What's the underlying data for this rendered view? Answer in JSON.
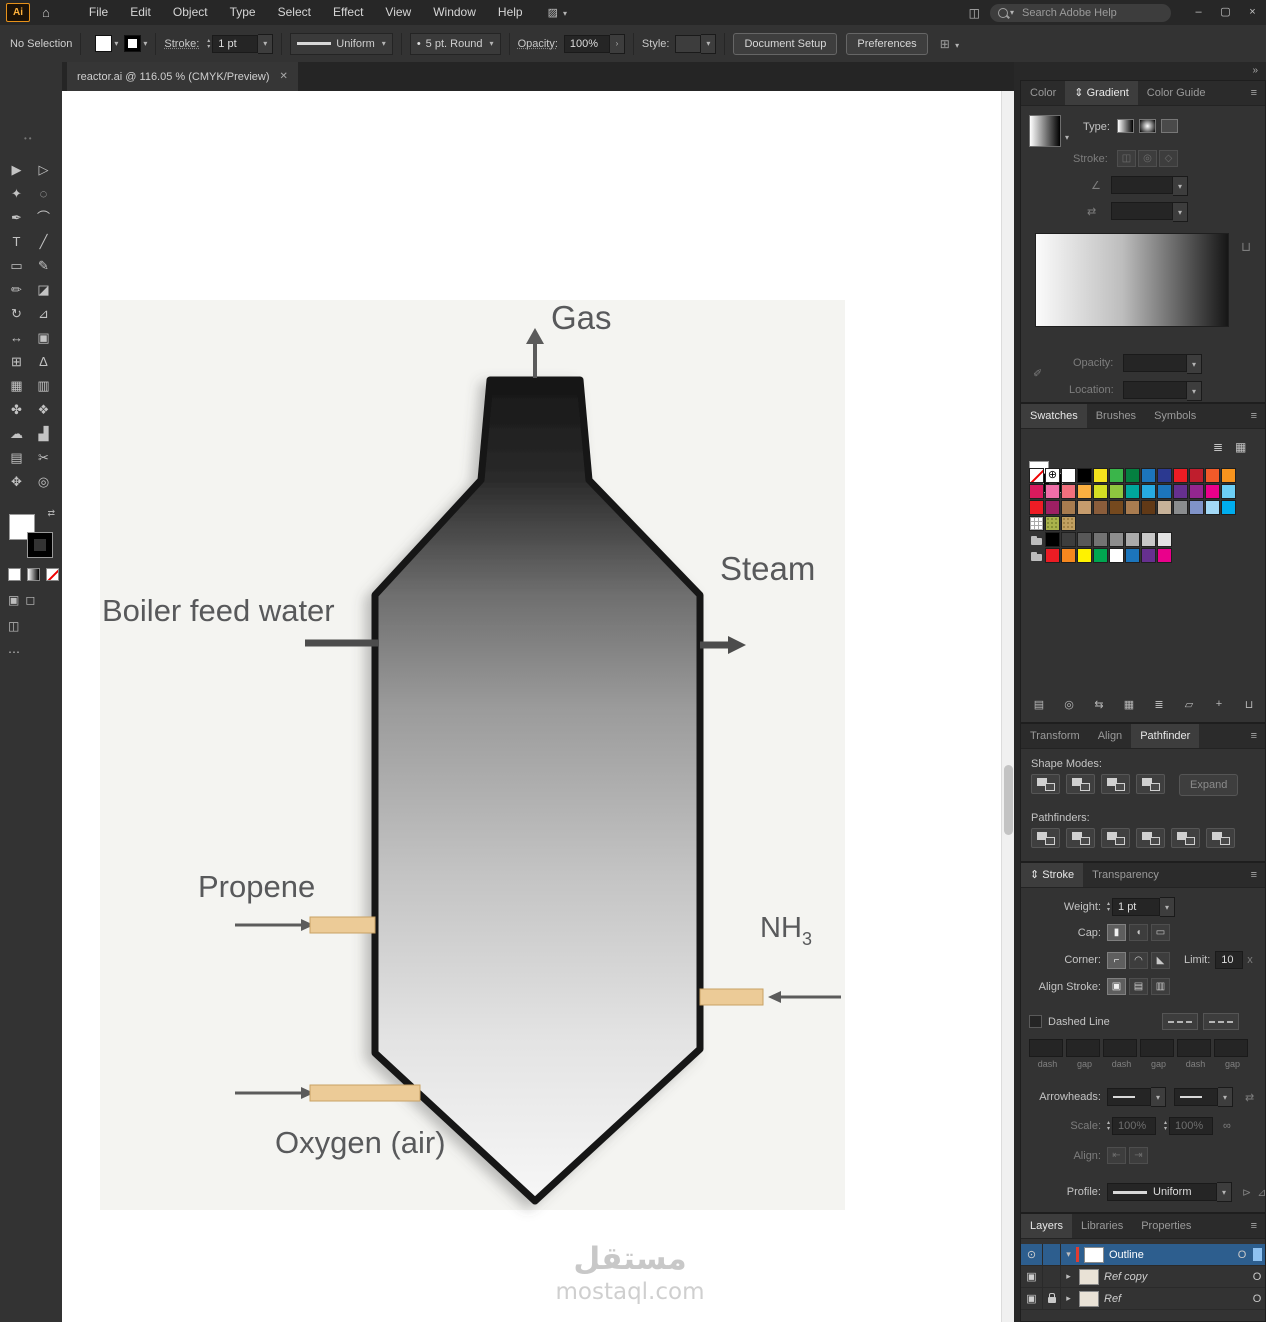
{
  "app": {
    "logo": "Ai",
    "menus": [
      "File",
      "Edit",
      "Object",
      "Type",
      "Select",
      "Effect",
      "View",
      "Window",
      "Help"
    ],
    "search": {
      "placeholder": "Search Adobe Help"
    },
    "window": {
      "minimize": "–",
      "restore": "▢",
      "close": "×"
    }
  },
  "control_bar": {
    "selection": "No Selection",
    "stroke_label": "Stroke:",
    "stroke_value": "1 pt",
    "variable_width": "Uniform",
    "brush": "5 pt. Round",
    "opacity_label": "Opacity:",
    "opacity_value": "100%",
    "style_label": "Style:",
    "document_setup": "Document Setup",
    "preferences": "Preferences"
  },
  "toolbar": {
    "tools": [
      {
        "name": "selection",
        "glyph": "▶"
      },
      {
        "name": "direct-selection",
        "glyph": "▷"
      },
      {
        "name": "magic-wand",
        "glyph": "✦"
      },
      {
        "name": "lasso",
        "glyph": "◌"
      },
      {
        "name": "pen",
        "glyph": "✒"
      },
      {
        "name": "curvature",
        "glyph": "⌒"
      },
      {
        "name": "type",
        "glyph": "T"
      },
      {
        "name": "line-segment",
        "glyph": "╱"
      },
      {
        "name": "rectangle",
        "glyph": "▭"
      },
      {
        "name": "paintbrush",
        "glyph": "✎"
      },
      {
        "name": "pencil",
        "glyph": "✏"
      },
      {
        "name": "eraser",
        "glyph": "◪"
      },
      {
        "name": "rotate",
        "glyph": "↻"
      },
      {
        "name": "scale",
        "glyph": "⊿"
      },
      {
        "name": "width",
        "glyph": "↔"
      },
      {
        "name": "free-transform",
        "glyph": "▣"
      },
      {
        "name": "shape-builder",
        "glyph": "⊞"
      },
      {
        "name": "perspective-grid",
        "glyph": "∆"
      },
      {
        "name": "mesh",
        "glyph": "▦"
      },
      {
        "name": "gradient",
        "glyph": "▥"
      },
      {
        "name": "eyedropper",
        "glyph": "✤"
      },
      {
        "name": "blend",
        "glyph": "❖"
      },
      {
        "name": "symbol-sprayer",
        "glyph": "☁"
      },
      {
        "name": "column-graph",
        "glyph": "▟"
      },
      {
        "name": "artboard",
        "glyph": "▤"
      },
      {
        "name": "slice",
        "glyph": "✂"
      },
      {
        "name": "hand",
        "glyph": "✥"
      },
      {
        "name": "zoom",
        "glyph": "◎"
      }
    ]
  },
  "document_tab": {
    "title": "reactor.ai @ 116.05 % (CMYK/Preview)",
    "close": "✕"
  },
  "diagram": {
    "gas": "Gas",
    "steam": "Steam",
    "boiler_feed_water": "Boiler feed water",
    "propene": "Propene",
    "nh": "NH",
    "nh_sub": "3",
    "oxygen": "Oxygen (air)",
    "watermark_line1": "مستقل",
    "watermark_line2": "mostaql.com",
    "pipe_color": "#eccb97",
    "pipe_border": "#c9a264",
    "label_color": "#58595b"
  },
  "panels": {
    "gradient": {
      "tabs": {
        "items": [
          "Color",
          "Gradient",
          "Color Guide"
        ],
        "active": 1,
        "prefix": "⇕"
      },
      "type_label": "Type:",
      "stroke_label": "Stroke:",
      "opacity_label": "Opacity:",
      "location_label": "Location:"
    },
    "swatches": {
      "tabs": {
        "items": [
          "Swatches",
          "Brushes",
          "Symbols"
        ],
        "active": 0
      },
      "rows": [
        [
          "none",
          "reg",
          "#ffffff",
          "#000000",
          "#f5e31c",
          "#3ab54a",
          "#047f40",
          "#1c75bc",
          "#2b3990",
          "#ed1c24",
          "#bf1e2d",
          "#f15a29",
          "#f7941e"
        ],
        [
          "#d91a5d",
          "#ef6ea8",
          "#f2707d",
          "#fbb041",
          "#d6de23",
          "#8ec63f",
          "#00a69c",
          "#27aae1",
          "#1c75bc",
          "#66308f",
          "#93268f",
          "#ea008b",
          "#6dcff6"
        ],
        [
          "#ee1c25",
          "#9e1f63",
          "#a87c4f",
          "#c69c6d",
          "#8a5d3b",
          "#75491e",
          "#a97c50",
          "#613916",
          "#c7b299",
          "#8a8c8e",
          "#8093c8",
          "#a3d9f6",
          "#00adee"
        ],
        [
          "pattern",
          "tex1",
          "tex2"
        ],
        [
          "folder",
          "#000000",
          "#3d3d3d",
          "#585858",
          "#737373",
          "#8e8e8e",
          "#ababab",
          "#c8c8c8",
          "#e3e3e3"
        ],
        [
          "folder",
          "#ec1c24",
          "#f6871f",
          "#fff200",
          "#00a650",
          "#ffffff",
          "#1c75bc",
          "#66308f",
          "#ea008b"
        ]
      ],
      "footer_icons": [
        {
          "n": "swatch-libraries-icon",
          "g": "▤"
        },
        {
          "n": "color-themes-icon",
          "g": "◎"
        },
        {
          "n": "swatch-kinds-icon",
          "g": "⇆"
        },
        {
          "n": "swatch-options-icon",
          "g": "▦"
        },
        {
          "n": "list-view-icon",
          "g": "≣"
        },
        {
          "n": "new-color-group-icon",
          "g": "▱"
        },
        {
          "n": "new-swatch-icon",
          "g": "+"
        },
        {
          "n": "delete-swatch-icon",
          "g": "⊔"
        }
      ]
    },
    "pathfinder": {
      "tabs": {
        "items": [
          "Transform",
          "Align",
          "Pathfinder"
        ],
        "active": 2
      },
      "shape_modes_label": "Shape Modes:",
      "pathfinders_label": "Pathfinders:",
      "expand": "Expand",
      "shape_modes": [
        {
          "n": "unite-icon"
        },
        {
          "n": "minus-front-icon"
        },
        {
          "n": "intersect-icon"
        },
        {
          "n": "exclude-icon"
        }
      ],
      "pathfinders": [
        {
          "n": "divide-icon"
        },
        {
          "n": "trim-icon"
        },
        {
          "n": "merge-icon"
        },
        {
          "n": "crop-icon"
        },
        {
          "n": "outline-icon"
        },
        {
          "n": "minus-back-icon"
        }
      ]
    },
    "stroke": {
      "tabs": {
        "items": [
          "Stroke",
          "Transparency"
        ],
        "active": 0,
        "prefix": "⇕"
      },
      "weight_label": "Weight:",
      "weight_value": "1 pt",
      "cap_label": "Cap:",
      "corner_label": "Corner:",
      "limit_label": "Limit:",
      "limit_value": "10",
      "limit_x": "x",
      "align_label": "Align Stroke:",
      "dashed_label": "Dashed Line",
      "dash_captions": [
        "dash",
        "gap",
        "dash",
        "gap",
        "dash",
        "gap"
      ],
      "arrowheads_label": "Arrowheads:",
      "scale_label": "Scale:",
      "scale_value1": "100%",
      "scale_value2": "100%",
      "align2_label": "Align:",
      "profile_label": "Profile:",
      "profile_value": "Uniform",
      "cap_icons": [
        {
          "n": "butt-cap-icon",
          "g": "▮",
          "on": true
        },
        {
          "n": "round-cap-icon",
          "g": "◖",
          "on": false
        },
        {
          "n": "projecting-cap-icon",
          "g": "▭",
          "on": false
        }
      ],
      "corner_icons": [
        {
          "n": "miter-join-icon",
          "g": "⌐",
          "on": true
        },
        {
          "n": "round-join-icon",
          "g": "◠",
          "on": false
        },
        {
          "n": "bevel-join-icon",
          "g": "◣",
          "on": false
        }
      ],
      "align_icons": [
        {
          "n": "align-stroke-center-icon",
          "g": "▣",
          "on": true
        },
        {
          "n": "align-stroke-inside-icon",
          "g": "▤",
          "on": false
        },
        {
          "n": "align-stroke-outside-icon",
          "g": "▥",
          "on": false
        }
      ],
      "align2_icons": [
        {
          "n": "arrow-align-start-icon",
          "g": "⇤",
          "dim": true
        },
        {
          "n": "arrow-align-end-icon",
          "g": "⇥",
          "dim": true
        }
      ]
    },
    "layers": {
      "tabs": {
        "items": [
          "Layers",
          "Libraries",
          "Properties"
        ],
        "active": 0
      },
      "target_glyph": "O",
      "rows": [
        {
          "name": "Outline",
          "selected": true,
          "eye": true,
          "lock": false,
          "expanded": true,
          "italic": false
        },
        {
          "name": "Ref copy",
          "selected": false,
          "eye": false,
          "lock": false,
          "expanded": false,
          "italic": true
        },
        {
          "name": "Ref",
          "selected": false,
          "eye": false,
          "lock": true,
          "expanded": false,
          "italic": true
        }
      ]
    }
  }
}
